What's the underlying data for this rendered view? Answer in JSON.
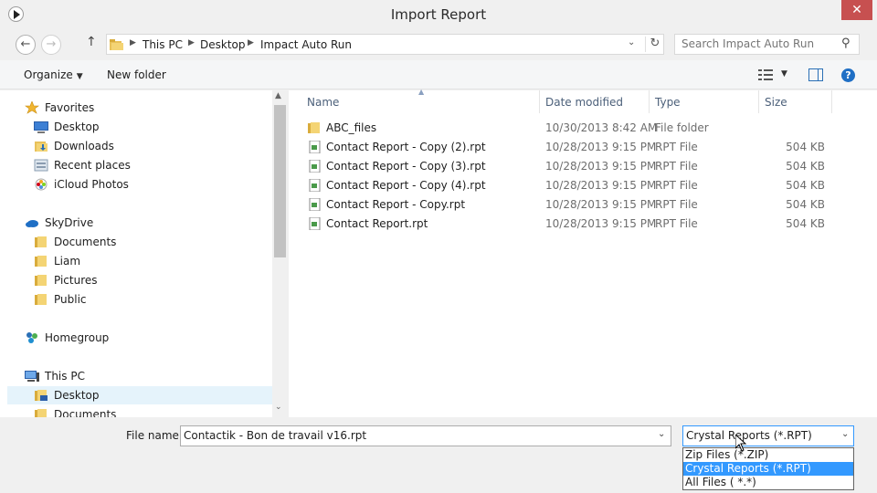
{
  "window": {
    "title": "Import Report",
    "close_label": "✕"
  },
  "navigation": {
    "breadcrumbs": [
      "This PC",
      "Desktop",
      "Impact Auto Run"
    ],
    "search_placeholder": "Search Impact Auto Run"
  },
  "toolbar": {
    "organize_label": "Organize",
    "new_folder_label": "New folder",
    "help_label": "?"
  },
  "sidebar": {
    "favorites": {
      "label": "Favorites",
      "items": [
        "Desktop",
        "Downloads",
        "Recent places",
        "iCloud Photos"
      ]
    },
    "skydrive": {
      "label": "SkyDrive",
      "items": [
        "Documents",
        "Liam",
        "Pictures",
        "Public"
      ]
    },
    "homegroup": {
      "label": "Homegroup"
    },
    "thispc": {
      "label": "This PC",
      "items": [
        "Desktop",
        "Documents"
      ]
    }
  },
  "file_list": {
    "columns": [
      "Name",
      "Date modified",
      "Type",
      "Size"
    ],
    "rows": [
      {
        "name": "ABC_files",
        "date": "10/30/2013 8:42 AM",
        "type": "File folder",
        "size": ""
      },
      {
        "name": "Contact Report - Copy (2).rpt",
        "date": "10/28/2013 9:15 PM",
        "type": "RPT File",
        "size": "504 KB"
      },
      {
        "name": "Contact Report - Copy (3).rpt",
        "date": "10/28/2013 9:15 PM",
        "type": "RPT File",
        "size": "504 KB"
      },
      {
        "name": "Contact Report - Copy (4).rpt",
        "date": "10/28/2013 9:15 PM",
        "type": "RPT File",
        "size": "504 KB"
      },
      {
        "name": "Contact Report - Copy.rpt",
        "date": "10/28/2013 9:15 PM",
        "type": "RPT File",
        "size": "504 KB"
      },
      {
        "name": "Contact Report.rpt",
        "date": "10/28/2013 9:15 PM",
        "type": "RPT File",
        "size": "504 KB"
      }
    ]
  },
  "footer": {
    "file_name_label": "File name:",
    "file_name_value": "Contactik - Bon de travail v16.rpt",
    "file_type_selected": "Crystal Reports (*.RPT)",
    "file_type_options": [
      "Zip Files (*.ZIP)",
      "Crystal Reports (*.RPT)",
      "All Files ( *.*)"
    ]
  },
  "colors": {
    "accent": "#3399ff",
    "close": "#c75050",
    "selection": "#e5f3fb"
  }
}
